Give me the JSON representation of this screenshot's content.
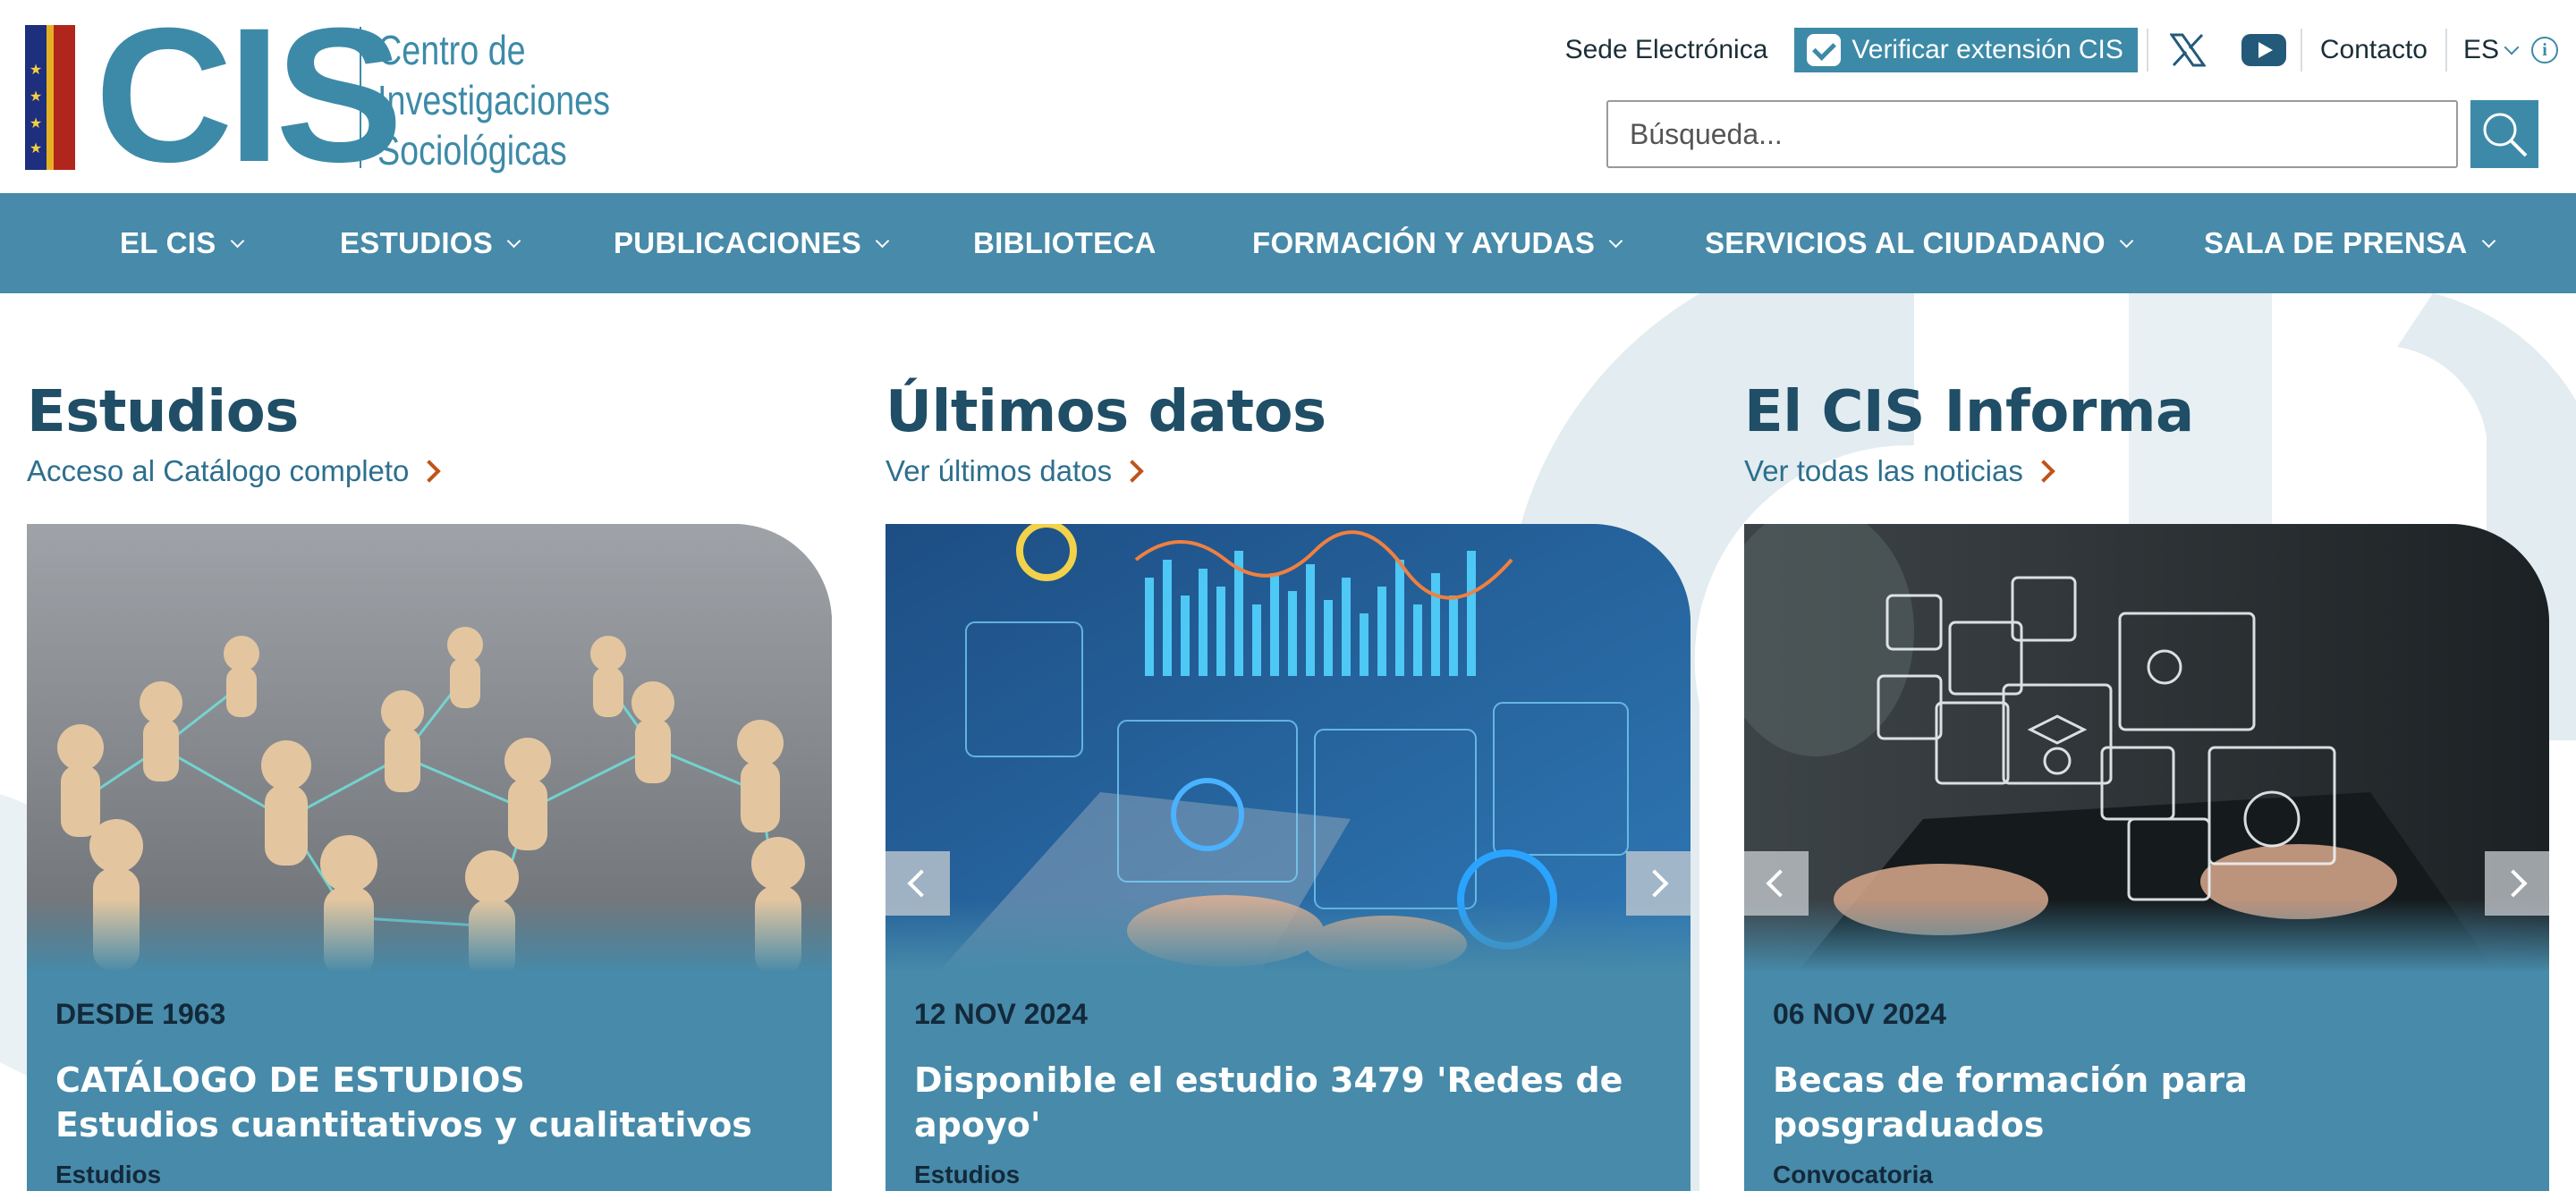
{
  "brand": {
    "name": "CIS",
    "subtitle_lines": [
      "Centro de",
      "Investigaciones",
      "Sociológicas"
    ],
    "primary_color": "#478aa9",
    "accent_color": "#c0531a"
  },
  "top_links": {
    "sede": "Sede Electrónica",
    "verify": "Verificar extensión CIS",
    "contact": "Contacto",
    "lang": "ES"
  },
  "search": {
    "placeholder": "Búsqueda..."
  },
  "nav": {
    "items": [
      {
        "label": "EL CIS",
        "dropdown": true
      },
      {
        "label": "ESTUDIOS",
        "dropdown": true
      },
      {
        "label": "PUBLICACIONES",
        "dropdown": true
      },
      {
        "label": "BIBLIOTECA",
        "dropdown": false
      },
      {
        "label": "FORMACIÓN Y AYUDAS",
        "dropdown": true
      },
      {
        "label": "SERVICIOS AL CIUDADANO",
        "dropdown": true
      },
      {
        "label": "SALA DE PRENSA",
        "dropdown": true
      }
    ]
  },
  "sections": [
    {
      "title": "Estudios",
      "link": "Acceso al Catálogo completo",
      "card": {
        "date": "DESDE 1963",
        "heading_line1": "CATÁLOGO DE ESTUDIOS",
        "heading_line2": "Estudios cuantitativos y cualitativos",
        "tag": "Estudios"
      }
    },
    {
      "title": "Últimos datos",
      "link": "Ver últimos datos",
      "card": {
        "date": "12 NOV 2024",
        "heading_line1": "Disponible el estudio 3479 'Redes de apoyo'",
        "heading_line2": "",
        "tag": "Estudios"
      }
    },
    {
      "title": "El CIS Informa",
      "link": "Ver todas las noticias",
      "card": {
        "date": "06 NOV 2024",
        "heading_line1": "Becas de formación para posgraduados",
        "heading_line2": "",
        "tag": "Convocatoria"
      }
    }
  ]
}
